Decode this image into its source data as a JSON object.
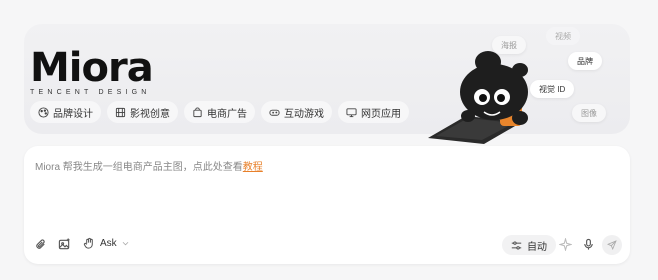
{
  "brand": {
    "name": "Miora",
    "subtitle": "TENCENT DESIGN"
  },
  "categories": [
    {
      "label": "品牌设计",
      "icon": "palette-icon"
    },
    {
      "label": "影视创意",
      "icon": "film-icon"
    },
    {
      "label": "电商广告",
      "icon": "shopping-bag-icon"
    },
    {
      "label": "互动游戏",
      "icon": "gamepad-icon"
    },
    {
      "label": "网页应用",
      "icon": "monitor-icon"
    }
  ],
  "tags": [
    "海报",
    "视频",
    "品牌",
    "视觉 ID",
    "图像"
  ],
  "composer": {
    "prompt": "Miora 帮我生成一组电商产品主图，点此处查看",
    "prompt_link": "教程",
    "mode": "Ask",
    "auto_label": "自动"
  },
  "colors": {
    "accent": "#e8802a",
    "background": "#f6f6f7"
  }
}
